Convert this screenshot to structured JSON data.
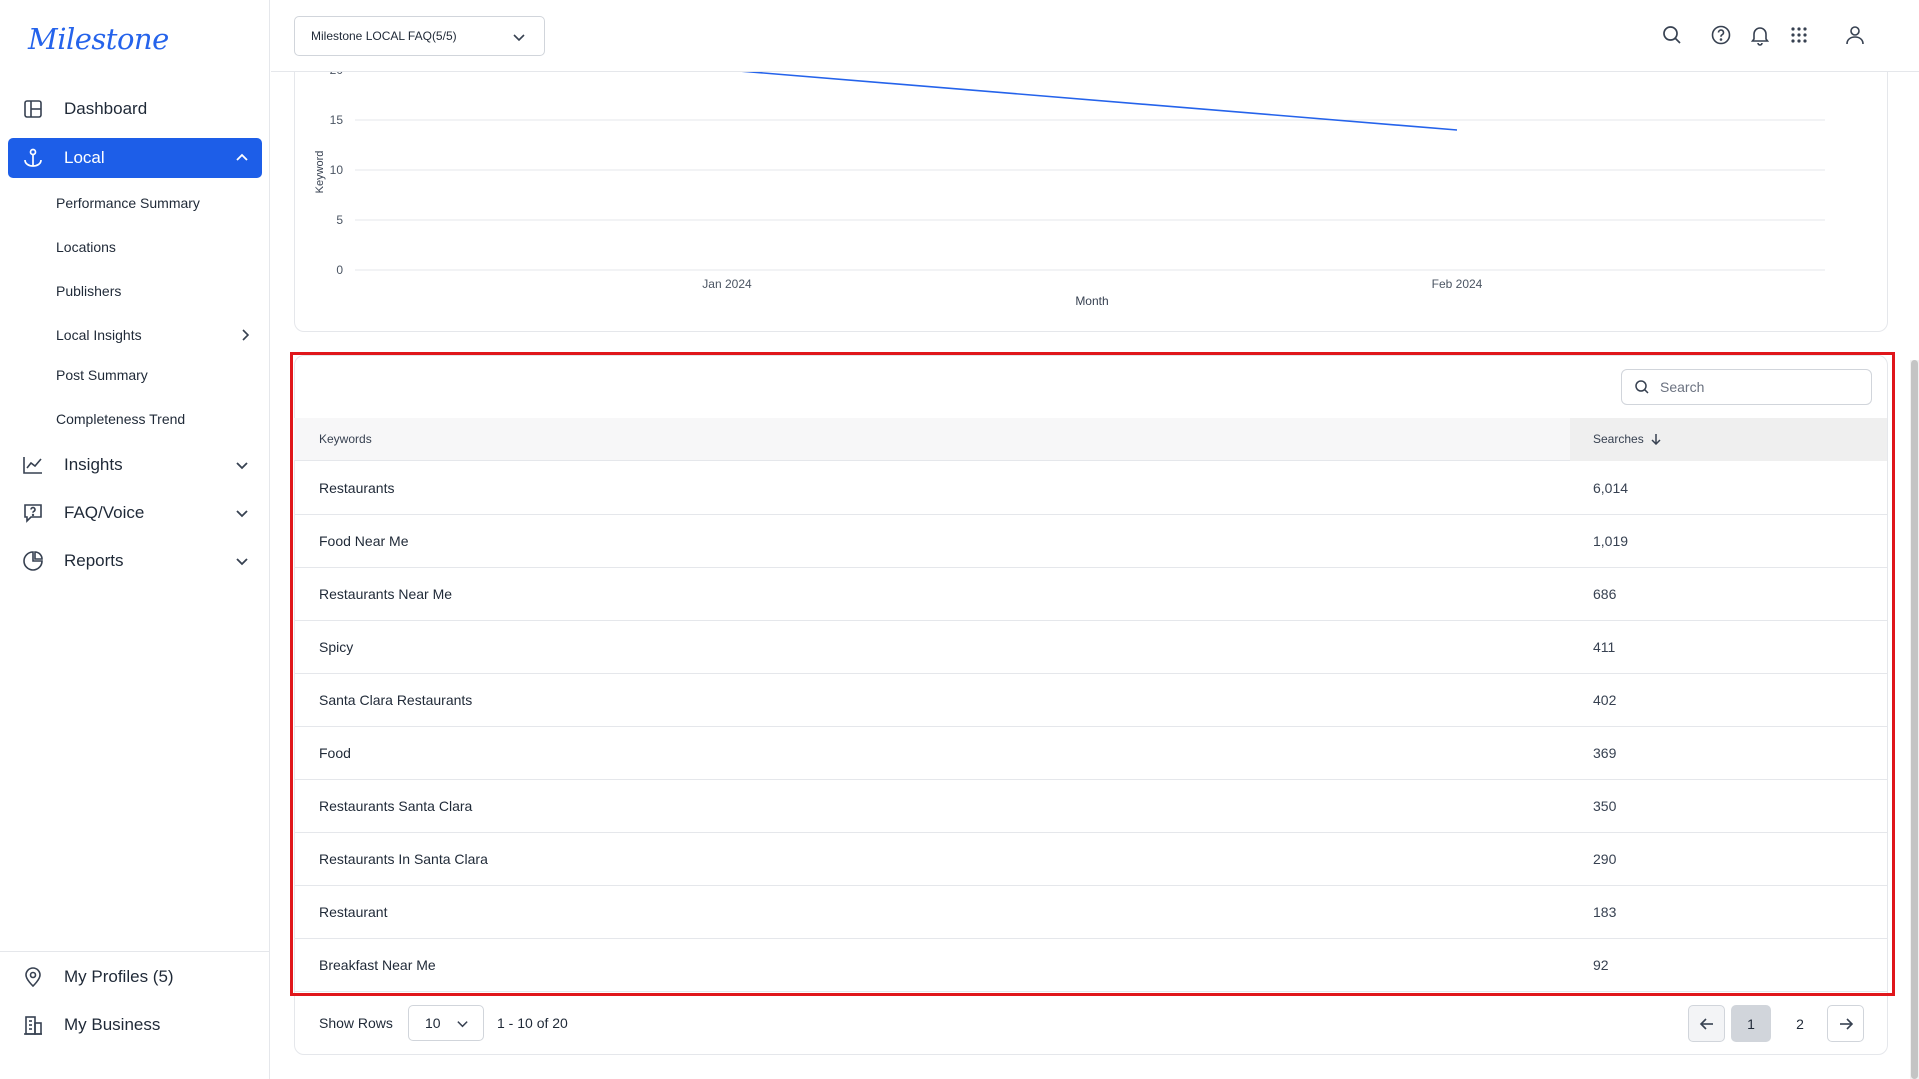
{
  "app": {
    "logo": "Milestone"
  },
  "sidebar": {
    "items": [
      {
        "label": "Dashboard"
      },
      {
        "label": "Local"
      },
      {
        "label": "Insights"
      },
      {
        "label": "FAQ/Voice"
      },
      {
        "label": "Reports"
      }
    ],
    "local_sub": [
      {
        "label": "Performance Summary"
      },
      {
        "label": "Locations"
      },
      {
        "label": "Publishers"
      },
      {
        "label": "Local Insights"
      },
      {
        "label": "Post Summary"
      },
      {
        "label": "Completeness Trend"
      }
    ],
    "bottom": [
      {
        "label": "My Profiles (5)"
      },
      {
        "label": "My Business"
      }
    ]
  },
  "topbar": {
    "selector": "Milestone LOCAL FAQ(5/5)",
    "icons": [
      "search-icon",
      "help-icon",
      "bell-icon",
      "apps-grid-icon",
      "user-icon"
    ]
  },
  "chart_data": {
    "type": "line",
    "categories": [
      "Jan 2024",
      "Feb 2024"
    ],
    "series": [
      {
        "values": [
          20,
          14
        ]
      }
    ],
    "xlabel": "Month",
    "ylabel": "Keyword",
    "yticks": [
      0,
      5,
      10,
      15
    ],
    "ylim": [
      0,
      20
    ],
    "grid": true,
    "color": "#2563eb"
  },
  "table": {
    "search_placeholder": "Search",
    "columns": {
      "keywords": "Keywords",
      "searches": "Searches"
    },
    "rows": [
      {
        "keyword": "Restaurants",
        "searches": "6,014"
      },
      {
        "keyword": "Food Near Me",
        "searches": "1,019"
      },
      {
        "keyword": "Restaurants Near Me",
        "searches": "686"
      },
      {
        "keyword": "Spicy",
        "searches": "411"
      },
      {
        "keyword": "Santa Clara Restaurants",
        "searches": "402"
      },
      {
        "keyword": "Food",
        "searches": "369"
      },
      {
        "keyword": "Restaurants Santa Clara",
        "searches": "350"
      },
      {
        "keyword": "Restaurants In Santa Clara",
        "searches": "290"
      },
      {
        "keyword": "Restaurant",
        "searches": "183"
      },
      {
        "keyword": "Breakfast Near Me",
        "searches": "92"
      }
    ]
  },
  "pagination": {
    "show_rows_label": "Show Rows",
    "rows_per_page": "10",
    "range": "1 - 10 of 20",
    "pages": [
      "1",
      "2"
    ]
  },
  "colors": {
    "accent": "#1d5ee8",
    "highlight": "#e0161b"
  }
}
